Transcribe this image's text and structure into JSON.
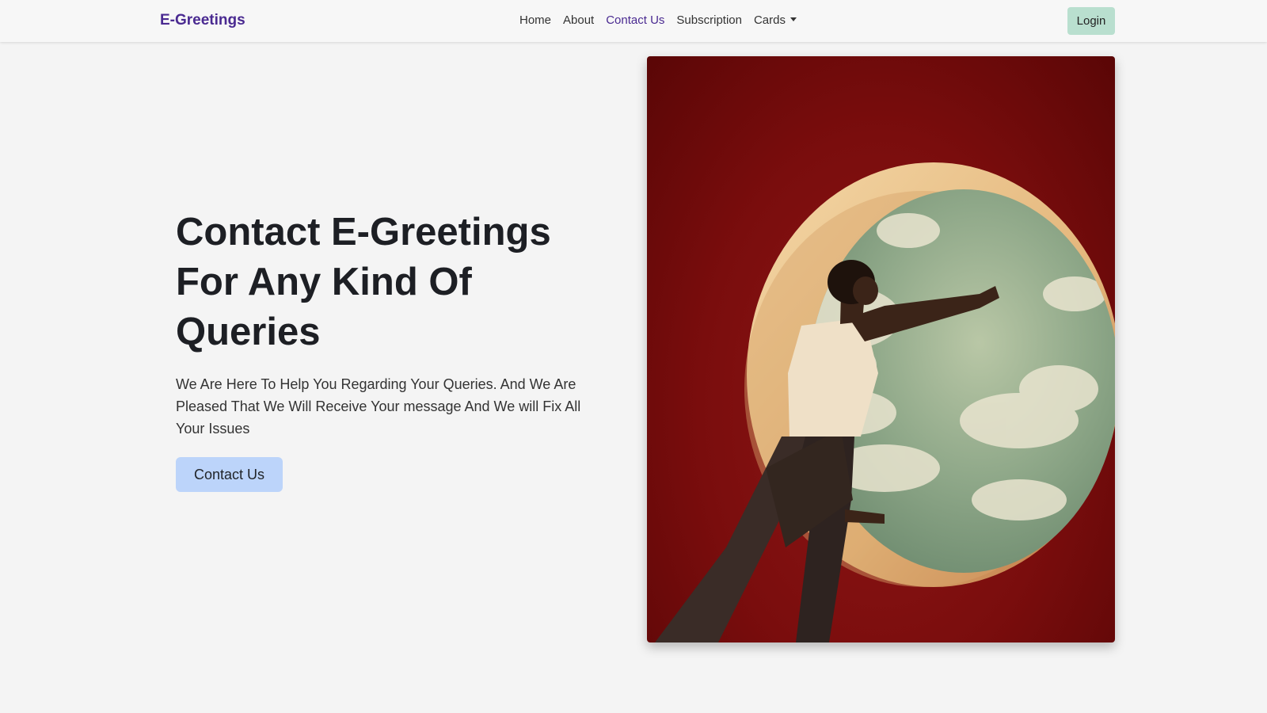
{
  "navbar": {
    "brand": "E-Greetings",
    "links": [
      {
        "label": "Home",
        "active": false
      },
      {
        "label": "About",
        "active": false
      },
      {
        "label": "Contact Us",
        "active": true
      },
      {
        "label": "Subscription",
        "active": false
      },
      {
        "label": "Cards",
        "active": false,
        "dropdown": true
      }
    ],
    "login_label": "Login"
  },
  "hero": {
    "title_line1": "Contact E-Greetings",
    "title_line2": "For Any Kind Of",
    "title_line3": "Queries",
    "text": "We Are Here To Help You Regarding Your Queries. And We Are Pleased That We Will Receive Your message And We will Fix All Your Issues",
    "cta_label": "Contact Us",
    "image_icon": "person-in-round-window-photo"
  },
  "colors": {
    "brand": "#4a2a91",
    "login_button": "#b9dfcf",
    "cta_button": "#bcd4fa",
    "background": "#f4f4f4",
    "photo_wall": "#7a0d0d"
  }
}
